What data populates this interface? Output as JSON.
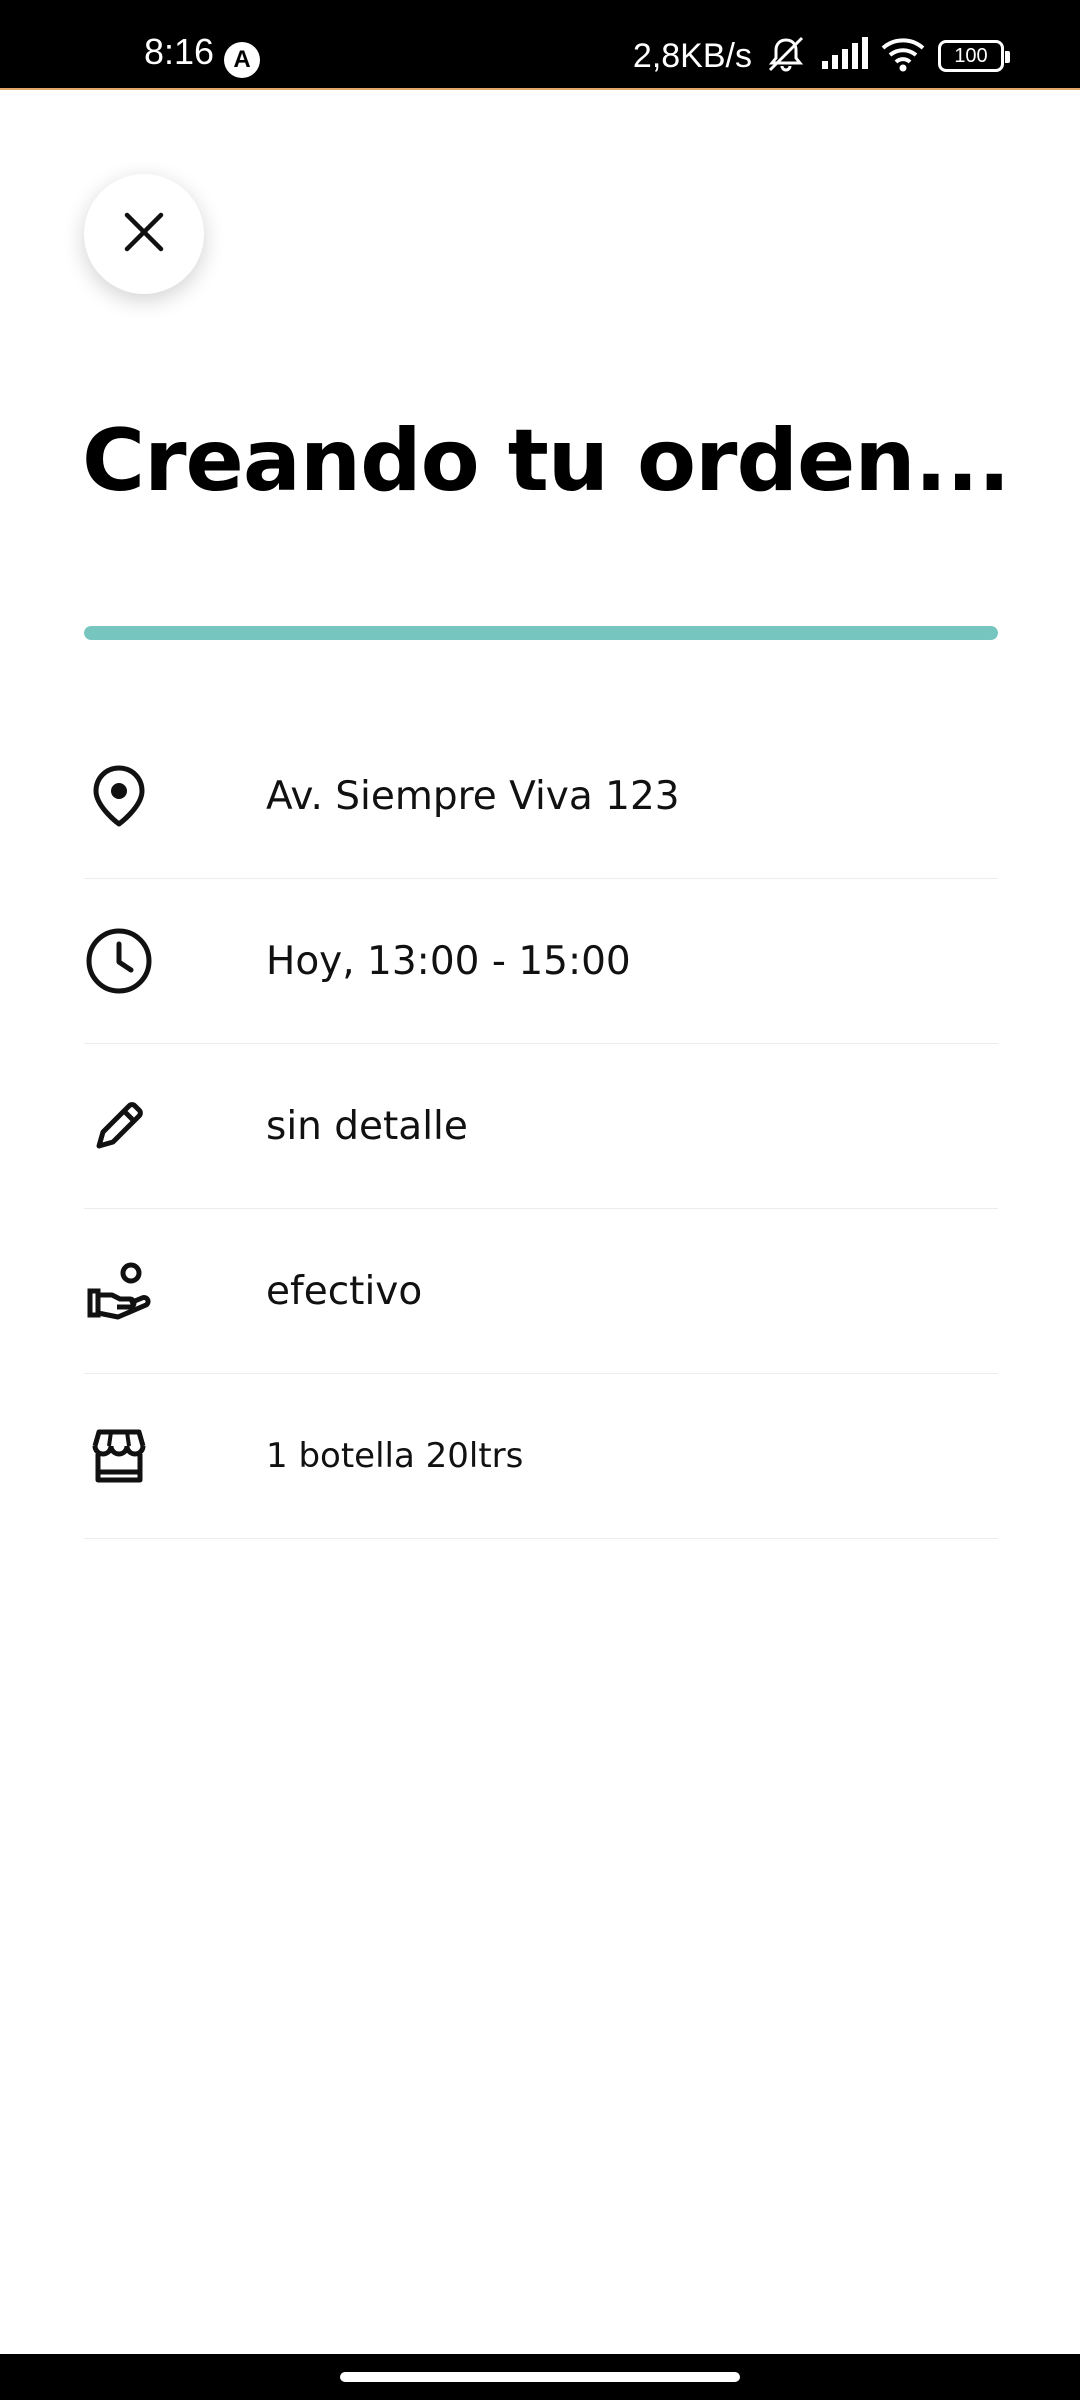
{
  "status_bar": {
    "time": "8:16",
    "app_icon_letter": "A",
    "network_speed": "2,8KB/s",
    "battery_level": "100"
  },
  "header": {
    "title": "Creando tu orden..."
  },
  "progress": {
    "fraction": 1.0,
    "color": "#76c6bf"
  },
  "details": [
    {
      "icon": "location-pin-icon",
      "text": "Av. Siempre Viva 123"
    },
    {
      "icon": "clock-icon",
      "text": "Hoy, 13:00 - 15:00"
    },
    {
      "icon": "pencil-icon",
      "text": "sin detalle"
    },
    {
      "icon": "hand-payment-icon",
      "text": "efectivo"
    },
    {
      "icon": "store-icon",
      "text": "1 botella 20ltrs"
    }
  ]
}
